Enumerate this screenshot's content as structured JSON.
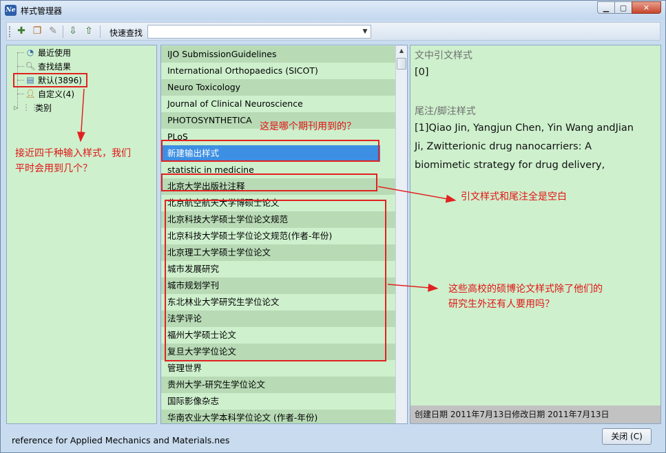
{
  "window": {
    "title": "样式管理器",
    "app_icon_text": "Ne"
  },
  "toolbar": {
    "search_label": "快速查找",
    "search_value": "",
    "icons": [
      "new-style-icon",
      "copy-style-icon",
      "delete-style-icon",
      "import-style-icon",
      "export-style-icon"
    ]
  },
  "tree": {
    "items": [
      {
        "label": "最近使用",
        "icon": "clock-icon"
      },
      {
        "label": "查找结果",
        "icon": "search-doc-icon"
      },
      {
        "label": "默认(3896)",
        "icon": "folder-icon"
      },
      {
        "label": "自定义(4)",
        "icon": "user-icon"
      },
      {
        "label": "类别",
        "icon": "category-icon"
      }
    ]
  },
  "style_list": {
    "items": [
      "IJO SubmissionGuidelines",
      "International Orthopaedics (SICOT)",
      "Neuro Toxicology",
      "Journal of Clinical Neuroscience",
      "PHOTOSYNTHETICA",
      "PLoS",
      "新建输出样式",
      "statistic in medicine",
      "北京大学出版社注释",
      "北京航空航天大学博硕士论文",
      "北京科技大学硕士学位论文规范",
      "北京科技大学硕士学位论文规范(作者-年份)",
      "北京理工大学硕士学位论文",
      "城市发展研究",
      "城市规划学刊",
      "东北林业大学研究生学位论文",
      "法学评论",
      "福州大学硕士论文",
      "复旦大学学位论文",
      "管理世界",
      "贵州大学-研究生学位论文",
      "国际影像杂志",
      "华南农业大学本科学位论文 (作者-年份)"
    ],
    "selected_index": 6
  },
  "preview": {
    "citation_heading": "文中引文样式",
    "citation_text": "[0]",
    "footnote_heading": "尾注/脚注样式",
    "footnote_lines": [
      "[1]Qiao Jin, Yangjun Chen, Yin Wang andJian",
      "Ji, Zwitterionic drug nanocarriers: A",
      "biomimetic strategy for drug delivery,"
    ],
    "footer": "创建日期  2011年7月13日修改日期  2011年7月13日"
  },
  "status": {
    "filename": "reference for Applied Mechanics and Materials.nes"
  },
  "buttons": {
    "close_label": "关闭 (C)"
  },
  "annotations": {
    "note_left": [
      "接近四千种输入样式，我们",
      "平时会用到几个？"
    ],
    "note_journal": "这是哪个期刊用到的？",
    "note_blank": "引文样式和尾注全是空白",
    "note_universities": [
      "这些高校的硕博论文样式除了他们的",
      "研究生外还有人要用吗？"
    ],
    "color": "#e22121"
  }
}
